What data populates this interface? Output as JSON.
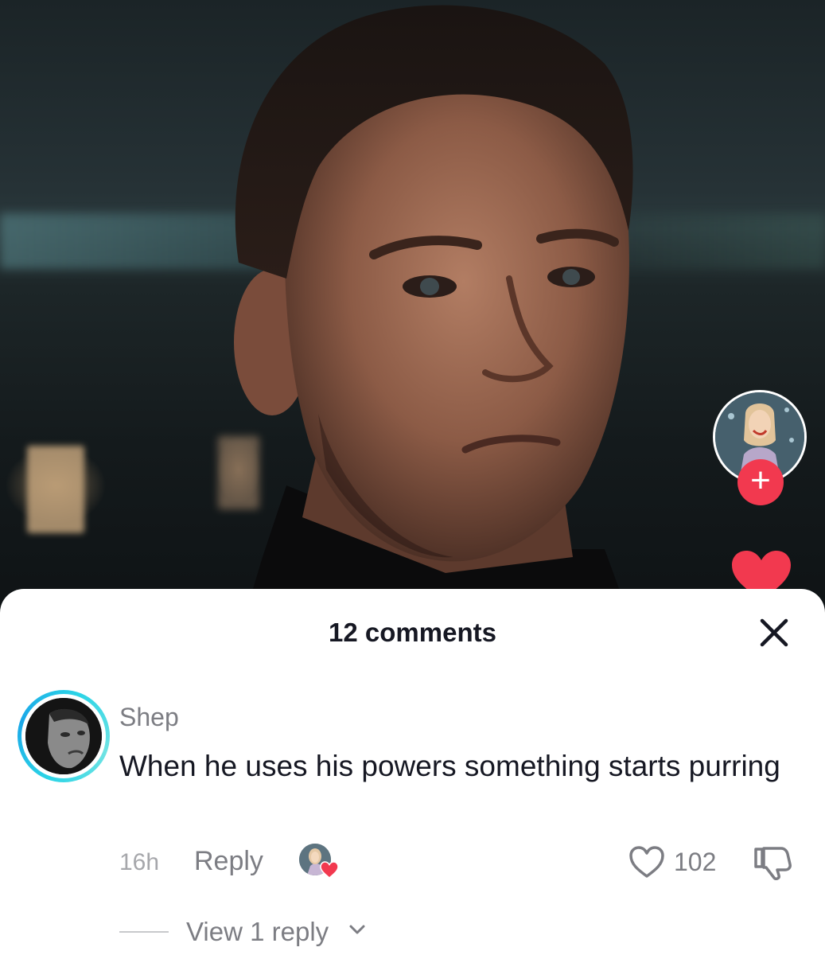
{
  "video": {
    "creator_avatar_icon": "creator-avatar",
    "follow_icon": "plus-icon",
    "follow_label": "+",
    "like_icon": "heart-icon",
    "accent_color": "#f2394f"
  },
  "comments_sheet": {
    "title": "12 comments",
    "close_icon": "close-icon",
    "comments": [
      {
        "username": "Shep",
        "text": "When he uses his powers something starts purring",
        "time": "16h",
        "reply_label": "Reply",
        "liked_by_creator": true,
        "like_count": "102",
        "view_replies_label": "View 1 reply"
      }
    ]
  }
}
